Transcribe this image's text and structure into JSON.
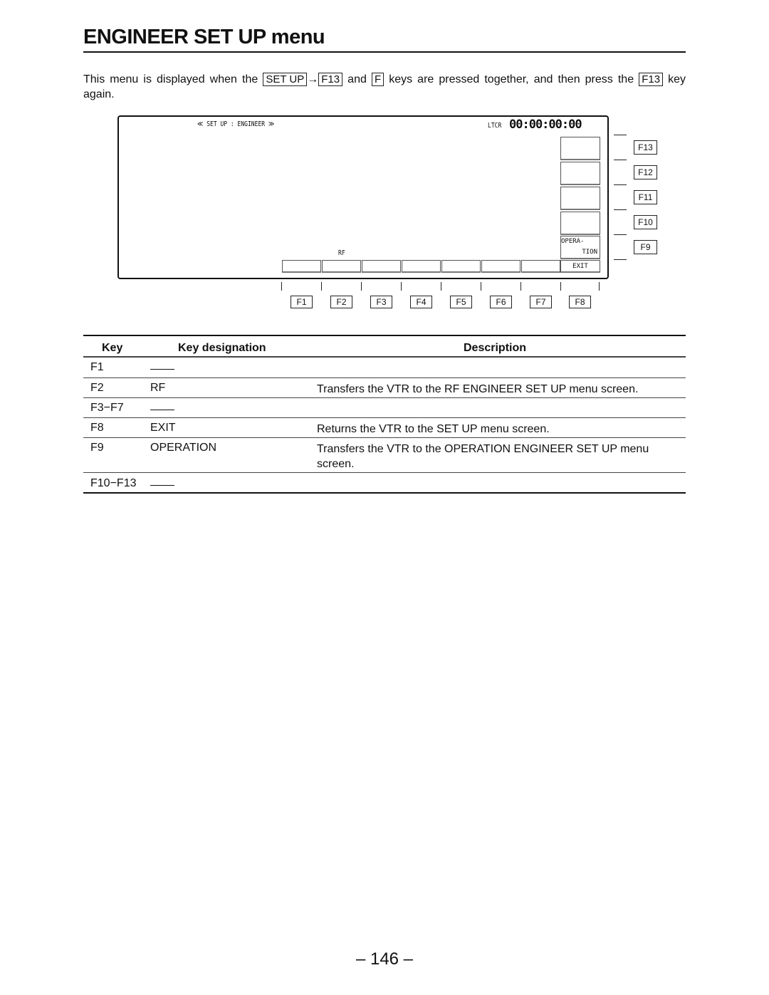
{
  "title": "ENGINEER SET UP menu",
  "intro": {
    "t1": "This menu is displayed when the",
    "k1": "SET UP",
    "arrow": "→",
    "k2": "F13",
    "t2": "and",
    "k3": "F",
    "t3": "keys are pressed together, and then press the",
    "k4": "F13",
    "t4": "key again."
  },
  "screen": {
    "header": "≪ SET UP : ENGINEER ≫",
    "tc_label": "LTCR",
    "timecode": "00:00:00:00",
    "f2_label": "RF",
    "f9_label_1": "OPERA-",
    "f9_label_2": "TION",
    "f8_label": "EXIT"
  },
  "bottom_keys": [
    "F1",
    "F2",
    "F3",
    "F4",
    "F5",
    "F6",
    "F7",
    "F8"
  ],
  "side_keys": [
    "F13",
    "F12",
    "F11",
    "F10",
    "F9"
  ],
  "table": {
    "headers": [
      "Key",
      "Key designation",
      "Description"
    ],
    "rows": [
      {
        "key": "F1",
        "designation": "——",
        "description": ""
      },
      {
        "key": "F2",
        "designation": "RF",
        "description": "Transfers the VTR to the RF ENGINEER SET UP menu screen."
      },
      {
        "key": "F3−F7",
        "designation": "——",
        "description": ""
      },
      {
        "key": "F8",
        "designation": "EXIT",
        "description": "Returns the VTR to the SET UP menu screen."
      },
      {
        "key": "F9",
        "designation": "OPERATION",
        "description": "Transfers the VTR to the OPERATION ENGINEER SET UP menu screen."
      },
      {
        "key": "F10−F13",
        "designation": "——",
        "description": ""
      }
    ]
  },
  "page_number": "– 146 –"
}
